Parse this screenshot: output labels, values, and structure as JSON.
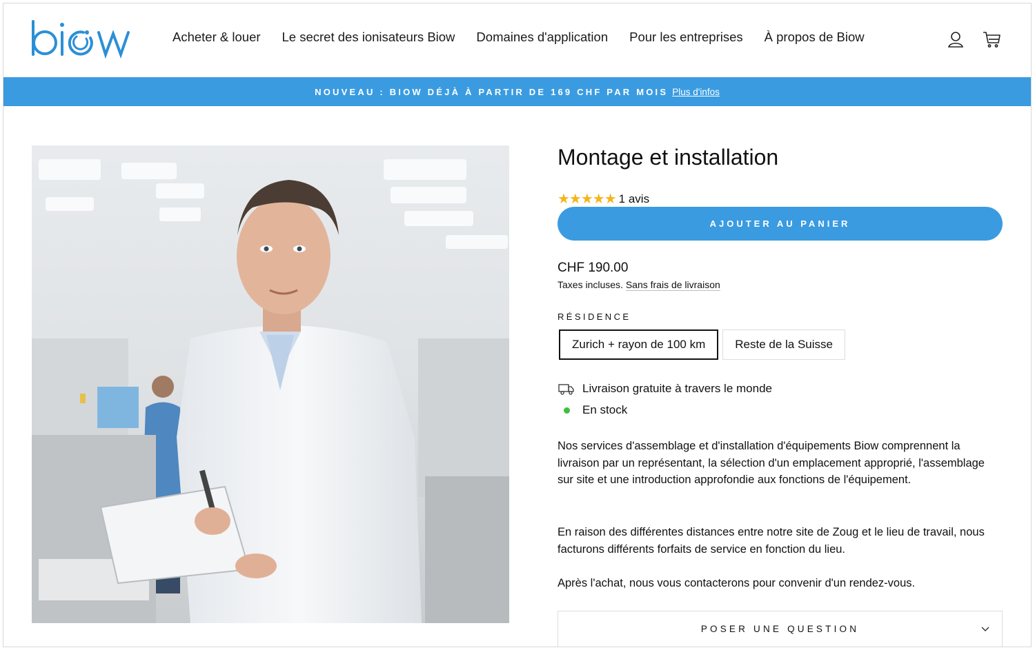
{
  "brand": {
    "logo_text": "biow",
    "accent_color": "#3a9be1"
  },
  "nav": {
    "items": [
      {
        "label": "Acheter & louer"
      },
      {
        "label": "Le secret des ionisateurs Biow"
      },
      {
        "label": "Domaines d'application"
      },
      {
        "label": "Pour les entreprises"
      },
      {
        "label": "À propos de Biow"
      }
    ],
    "icons": [
      "user-icon",
      "cart-icon"
    ]
  },
  "announcement": {
    "text": "NOUVEAU : BIOW DÉJÀ À PARTIR DE 169 CHF PAR MOIS",
    "link": "Plus d'infos"
  },
  "product": {
    "title": "Montage et installation",
    "rating": {
      "stars": 5,
      "reviews": "1 avis",
      "star_color": "#f5b51b"
    },
    "add_to_cart": "AJOUTER AU PANIER",
    "price": "CHF 190.00",
    "tax_note": "Taxes incluses.",
    "shipping_link": "Sans frais de livraison",
    "variant_label": "RÉSIDENCE",
    "variants": [
      {
        "label": "Zurich + rayon de 100 km",
        "selected": true
      },
      {
        "label": "Reste de la Suisse",
        "selected": false
      }
    ],
    "features": [
      {
        "icon": "truck-icon",
        "text": "Livraison gratuite à travers le monde"
      },
      {
        "icon": "stock-dot-icon",
        "text": "En stock",
        "color": "#3cc13b"
      }
    ],
    "description": [
      "Nos services d'assemblage et d'installation d'équipements Biow comprennent la livraison par un représentant, la sélection d'un emplacement approprié, l'assemblage sur site et une introduction approfondie aux fonctions de l'équipement.",
      "En raison des différentes distances entre notre site de Zoug et le lieu de travail, nous facturons différents forfaits de service en fonction du lieu.",
      "Après l'achat, nous vous contacterons pour convenir d'un rendez-vous."
    ],
    "ask_question": "POSER UNE QUESTION"
  }
}
